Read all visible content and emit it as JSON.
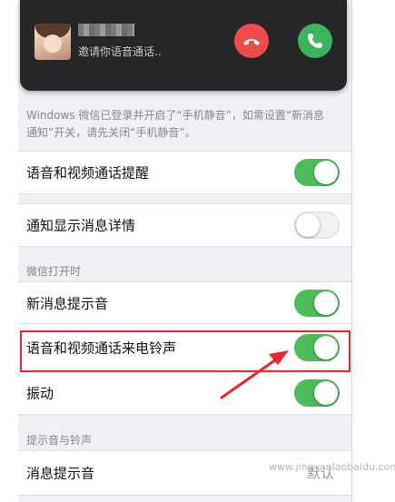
{
  "call": {
    "status_text": "邀请你语音通话..",
    "accent_decline": "#ee4b4b",
    "accent_accept": "#3ab55a"
  },
  "notice": {
    "line1": "Windows 微信已登录并开启了“手机静音”，如需设置“新消息",
    "line2": "通知”开关，请先关闭“手机静音”。"
  },
  "settings": {
    "voice_video_alert": {
      "label": "语音和视频通话提醒",
      "toggle": "on"
    },
    "show_details": {
      "label": "通知显示消息详情",
      "toggle": "off"
    },
    "section_when_open": "微信打开时",
    "new_msg_sound": {
      "label": "新消息提示音",
      "toggle": "on"
    },
    "call_ringtone": {
      "label": "语音和视频通话来电铃声",
      "toggle": "on"
    },
    "vibrate": {
      "label": "振动",
      "toggle": "on"
    },
    "section_sounds": "提示音与铃声",
    "msg_sound": {
      "label": "消息提示音",
      "value": "默认"
    }
  },
  "annotation": {
    "highlight_color": "#e8262b"
  },
  "watermark": "www.jingyanlaobaidu.com"
}
